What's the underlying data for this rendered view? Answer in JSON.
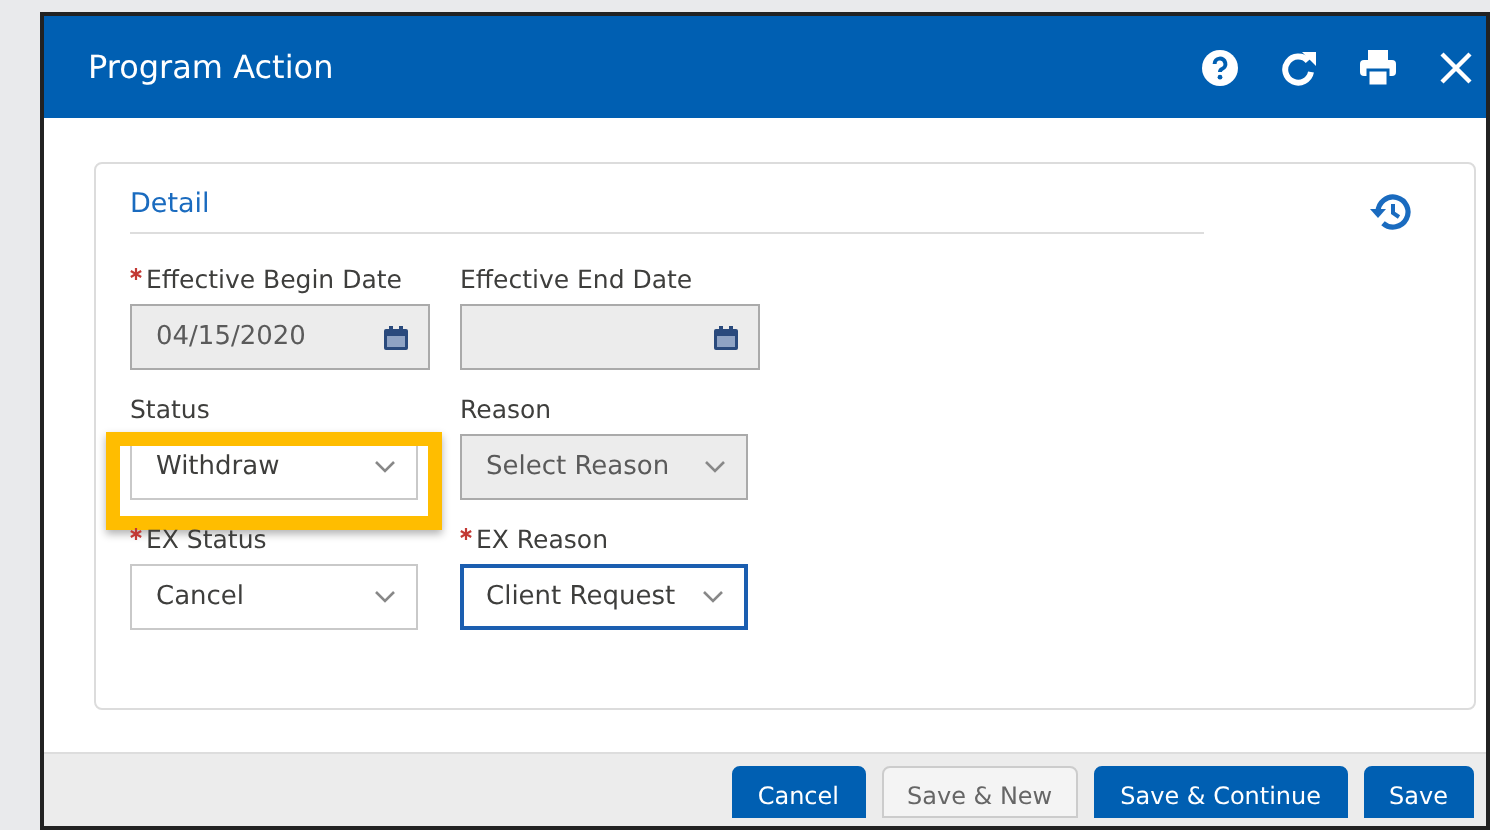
{
  "window": {
    "title": "Program Action"
  },
  "section": {
    "title": "Detail"
  },
  "fields": [
    {
      "kind": "date",
      "label": "Effective Begin Date",
      "required": true,
      "value": "04/15/2020",
      "disabled": true,
      "focused": false,
      "highlighted": false
    },
    {
      "kind": "date",
      "label": "Effective End Date",
      "required": false,
      "disabled": true,
      "focused": false,
      "highlighted": false
    },
    {
      "kind": "select",
      "label": "Status",
      "required": false,
      "value": "Withdraw",
      "disabled": false,
      "focused": false,
      "highlighted": true
    },
    {
      "kind": "select",
      "label": "Reason",
      "required": false,
      "placeholder": "Select Reason",
      "disabled": true,
      "focused": false,
      "highlighted": false
    },
    {
      "kind": "select",
      "label": "EX Status",
      "required": true,
      "value": "Cancel",
      "disabled": false,
      "focused": false,
      "highlighted": false
    },
    {
      "kind": "select",
      "label": "EX Reason",
      "required": true,
      "value": "Client Request",
      "disabled": false,
      "focused": true,
      "highlighted": false
    }
  ],
  "buttons": [
    {
      "label": "Cancel",
      "primary": true
    },
    {
      "label": "Save & New",
      "primary": false
    },
    {
      "label": "Save & Continue",
      "primary": true
    },
    {
      "label": "Save",
      "primary": true
    }
  ]
}
